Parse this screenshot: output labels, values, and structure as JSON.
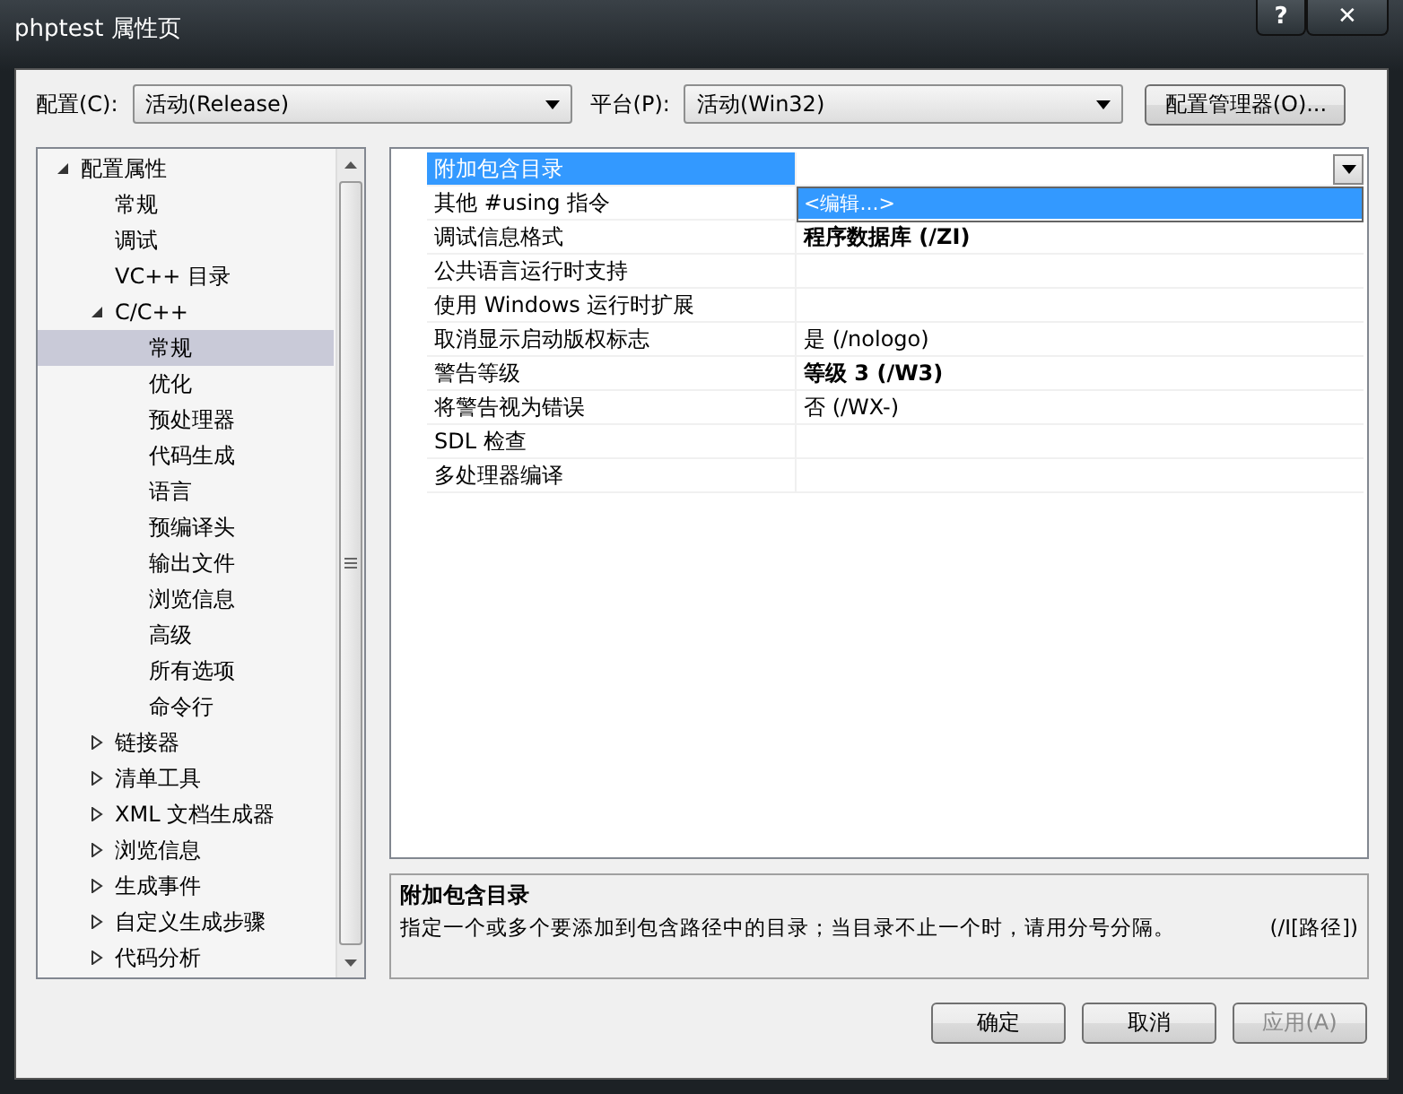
{
  "window": {
    "title": "phptest 属性页",
    "buttons": [
      {
        "kind": "help",
        "label": "?"
      },
      {
        "kind": "close",
        "label": "✕"
      }
    ]
  },
  "config_bar": {
    "configuration_label": "配置(C):",
    "configuration": "活动(Release)",
    "platform_label": "平台(P):",
    "platform": "活动(Win32)",
    "manager_button": "配置管理器(O)..."
  },
  "tree": [
    {
      "label": "配置属性",
      "expanded": true,
      "selected": false,
      "children": [
        {
          "label": "常规",
          "selected": false
        },
        {
          "label": "调试",
          "selected": false
        },
        {
          "label": "VC++ 目录",
          "selected": false
        },
        {
          "label": "C/C++",
          "expanded": true,
          "selected": false,
          "children": [
            {
              "label": "常规",
              "selected": true
            },
            {
              "label": "优化",
              "selected": false
            },
            {
              "label": "预处理器",
              "selected": false
            },
            {
              "label": "代码生成",
              "selected": false
            },
            {
              "label": "语言",
              "selected": false
            },
            {
              "label": "预编译头",
              "selected": false
            },
            {
              "label": "输出文件",
              "selected": false
            },
            {
              "label": "浏览信息",
              "selected": false
            },
            {
              "label": "高级",
              "selected": false
            },
            {
              "label": "所有选项",
              "selected": false
            },
            {
              "label": "命令行",
              "selected": false
            }
          ]
        },
        {
          "label": "链接器",
          "expanded": false,
          "selected": false
        },
        {
          "label": "清单工具",
          "expanded": false,
          "selected": false
        },
        {
          "label": "XML 文档生成器",
          "expanded": false,
          "selected": false
        },
        {
          "label": "浏览信息",
          "expanded": false,
          "selected": false
        },
        {
          "label": "生成事件",
          "expanded": false,
          "selected": false
        },
        {
          "label": "自定义生成步骤",
          "expanded": false,
          "selected": false
        },
        {
          "label": "代码分析",
          "expanded": false,
          "selected": false
        }
      ]
    }
  ],
  "properties": [
    {
      "name": "附加包含目录",
      "selected": true,
      "dropdown": {
        "items": [
          {
            "label": "<编辑...>",
            "selected": true
          }
        ]
      }
    },
    {
      "name": "其他 #using 指令",
      "selected": false
    },
    {
      "name": "调试信息格式",
      "value": "程序数据库 (/ZI)",
      "bold": true,
      "selected": false
    },
    {
      "name": "公共语言运行时支持",
      "selected": false
    },
    {
      "name": "使用 Windows 运行时扩展",
      "selected": false
    },
    {
      "name": "取消显示启动版权标志",
      "value": "是 (/nologo)",
      "bold": false,
      "selected": false
    },
    {
      "name": "警告等级",
      "value": "等级 3 (/W3)",
      "bold": true,
      "selected": false
    },
    {
      "name": "将警告视为错误",
      "value": "否 (/WX-)",
      "bold": false,
      "selected": false
    },
    {
      "name": "SDL 检查",
      "selected": false
    },
    {
      "name": "多处理器编译",
      "selected": false
    }
  ],
  "description": {
    "title": "附加包含目录",
    "text": "指定一个或多个要添加到包含路径中的目录；当目录不止一个时，请用分号分隔。",
    "switch": "(/I[路径])"
  },
  "footer_buttons": [
    {
      "label": "确定",
      "disabled": false
    },
    {
      "label": "取消",
      "disabled": false
    },
    {
      "label": "应用(A)",
      "disabled": true
    }
  ]
}
